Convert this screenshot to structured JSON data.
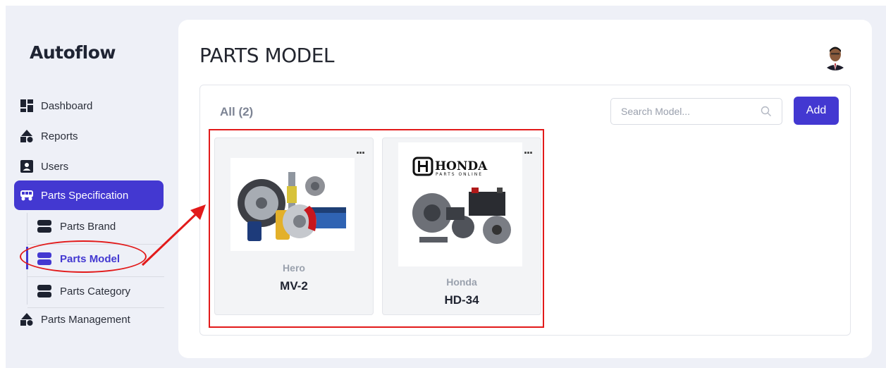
{
  "app": {
    "name": "Autoflow"
  },
  "sidebar": {
    "items": [
      {
        "label": "Dashboard",
        "icon": "grid-icon"
      },
      {
        "label": "Reports",
        "icon": "shapes-icon"
      },
      {
        "label": "Users",
        "icon": "user-card-icon"
      },
      {
        "label": "Parts Specification",
        "icon": "van-icon",
        "active": true
      },
      {
        "label": "Parts Management",
        "icon": "shapes-icon"
      }
    ],
    "subitems": [
      {
        "label": "Parts Brand",
        "icon": "stack-icon"
      },
      {
        "label": "Parts Model",
        "icon": "stack-icon",
        "active": true
      },
      {
        "label": "Parts Category",
        "icon": "stack-icon"
      }
    ]
  },
  "header": {
    "title": "PARTS MODEL"
  },
  "toolbar": {
    "filter_label": "All (2)",
    "search_placeholder": "Search Model...",
    "add_label": "Add"
  },
  "cards": [
    {
      "brand": "Hero",
      "model": "MV-2",
      "menu": "..."
    },
    {
      "brand": "Honda",
      "model": "HD-34",
      "menu": "...",
      "logo_text": "HONDA",
      "logo_sub": "PARTS ONLINE"
    }
  ],
  "colors": {
    "accent": "#4338d1",
    "annotation": "#e21a1a",
    "background": "#eef0f7"
  }
}
